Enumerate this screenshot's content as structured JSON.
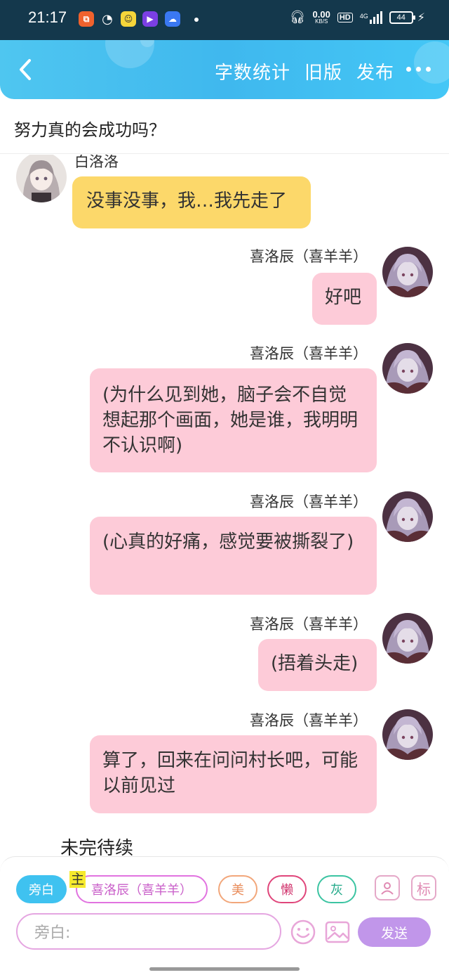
{
  "status_bar": {
    "time": "21:17",
    "net_speed_value": "0.00",
    "net_speed_unit": "KB/S",
    "hd_label": "HD",
    "network": "4G",
    "battery": "44",
    "icons": [
      "app-icon-orange",
      "wechat-icon",
      "chat-app-icon",
      "video-app-icon",
      "cloud-app-icon",
      "headphones-icon",
      "signal-icon",
      "charging-icon"
    ]
  },
  "header": {
    "actions": [
      "字数统计",
      "旧版",
      "发布"
    ],
    "back_icon": "chevron-left-icon",
    "more_icon": "more-dots-icon"
  },
  "title": "努力真的会成功吗？",
  "messages": [
    {
      "side": "left",
      "name": "白洛洛",
      "text": "没事没事，我…我先走了",
      "bubble_color": "#fcd86a"
    },
    {
      "side": "right",
      "name": "喜洛辰（喜羊羊）",
      "text": "好吧",
      "bubble_color": "#fdcbd8"
    },
    {
      "side": "right",
      "name": "喜洛辰（喜羊羊）",
      "text": "(为什么见到她，脑子会不自觉想起那个画面，她是谁，我明明不认识啊)",
      "bubble_color": "#fdcbd8"
    },
    {
      "side": "right",
      "name": "喜洛辰（喜羊羊）",
      "text": "(心真的好痛，感觉要被撕裂了)",
      "bubble_color": "#fdcbd8"
    },
    {
      "side": "right",
      "name": "喜洛辰（喜羊羊）",
      "text": "(捂着头走)",
      "bubble_color": "#fdcbd8"
    },
    {
      "side": "right",
      "name": "喜洛辰（喜羊羊）",
      "text": "算了，回来在问问村长吧，可能以前见过",
      "bubble_color": "#fdcbd8"
    }
  ],
  "to_be_continued": "未完待续",
  "toolbar": {
    "aside_label": "旁白",
    "main_mark": "主",
    "role_label": "喜洛辰（喜羊羊）",
    "chips": [
      "美",
      "懒",
      "灰"
    ],
    "mark_label": "标",
    "input_placeholder": "旁白:",
    "send_label": "发送"
  },
  "colors": {
    "header_blue": "#3fb8ee",
    "pink_bubble": "#fdcbd8",
    "yellow_bubble": "#fcd86a",
    "send_purple": "#c196ea"
  }
}
